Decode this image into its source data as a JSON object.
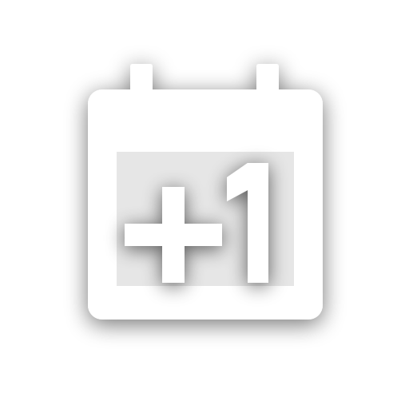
{
  "icon": {
    "name": "calendar-plus-one-icon",
    "badge_text": "+1"
  },
  "colors": {
    "background": "#ffffff",
    "icon_fill": "#ffffff",
    "shadow": "#000000"
  }
}
